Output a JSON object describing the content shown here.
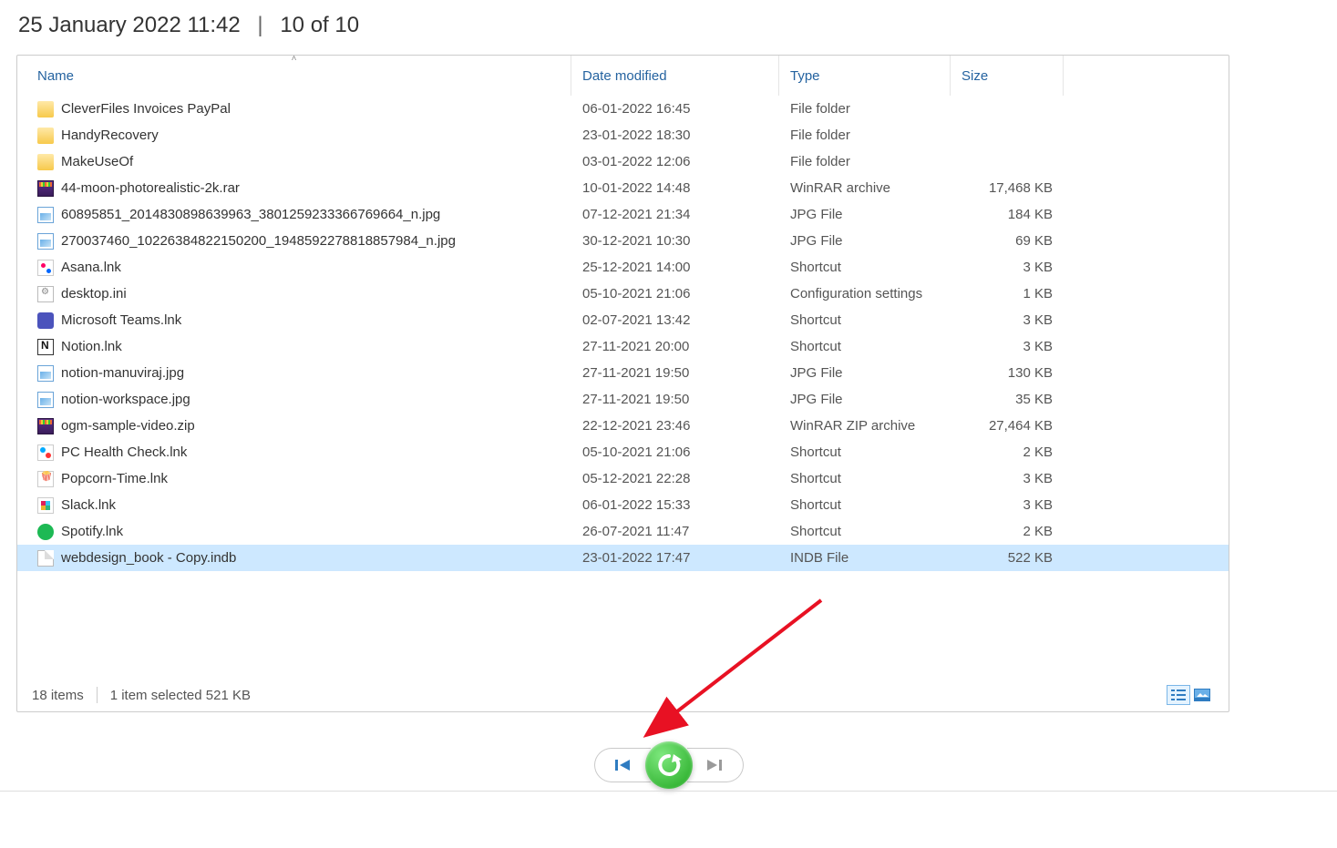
{
  "header": {
    "timestamp": "25 January 2022 11:42",
    "position": "10 of 10"
  },
  "columns": {
    "name": "Name",
    "date": "Date modified",
    "type": "Type",
    "size": "Size"
  },
  "files": [
    {
      "icon": "folder",
      "name": "CleverFiles Invoices PayPal",
      "date": "06-01-2022 16:45",
      "type": "File folder",
      "size": ""
    },
    {
      "icon": "folder",
      "name": "HandyRecovery",
      "date": "23-01-2022 18:30",
      "type": "File folder",
      "size": ""
    },
    {
      "icon": "folder",
      "name": "MakeUseOf",
      "date": "03-01-2022 12:06",
      "type": "File folder",
      "size": ""
    },
    {
      "icon": "rar",
      "name": "44-moon-photorealistic-2k.rar",
      "date": "10-01-2022 14:48",
      "type": "WinRAR archive",
      "size": "17,468 KB"
    },
    {
      "icon": "jpg",
      "name": "60895851_2014830898639963_3801259233366769664_n.jpg",
      "date": "07-12-2021 21:34",
      "type": "JPG File",
      "size": "184 KB"
    },
    {
      "icon": "jpg",
      "name": "270037460_10226384822150200_1948592278818857984_n.jpg",
      "date": "30-12-2021 10:30",
      "type": "JPG File",
      "size": "69 KB"
    },
    {
      "icon": "lnk-asana",
      "name": "Asana.lnk",
      "date": "25-12-2021 14:00",
      "type": "Shortcut",
      "size": "3 KB"
    },
    {
      "icon": "ini",
      "name": "desktop.ini",
      "date": "05-10-2021 21:06",
      "type": "Configuration settings",
      "size": "1 KB"
    },
    {
      "icon": "teams",
      "name": "Microsoft Teams.lnk",
      "date": "02-07-2021 13:42",
      "type": "Shortcut",
      "size": "3 KB"
    },
    {
      "icon": "notion",
      "name": "Notion.lnk",
      "date": "27-11-2021 20:00",
      "type": "Shortcut",
      "size": "3 KB"
    },
    {
      "icon": "jpg",
      "name": "notion-manuviraj.jpg",
      "date": "27-11-2021 19:50",
      "type": "JPG File",
      "size": "130 KB"
    },
    {
      "icon": "jpg",
      "name": "notion-workspace.jpg",
      "date": "27-11-2021 19:50",
      "type": "JPG File",
      "size": "35 KB"
    },
    {
      "icon": "zip",
      "name": "ogm-sample-video.zip",
      "date": "22-12-2021 23:46",
      "type": "WinRAR ZIP archive",
      "size": "27,464 KB"
    },
    {
      "icon": "pchc",
      "name": "PC Health Check.lnk",
      "date": "05-10-2021 21:06",
      "type": "Shortcut",
      "size": "2 KB"
    },
    {
      "icon": "popcorn",
      "name": "Popcorn-Time.lnk",
      "date": "05-12-2021 22:28",
      "type": "Shortcut",
      "size": "3 KB"
    },
    {
      "icon": "slack",
      "name": "Slack.lnk",
      "date": "06-01-2022 15:33",
      "type": "Shortcut",
      "size": "3 KB"
    },
    {
      "icon": "spotify",
      "name": "Spotify.lnk",
      "date": "26-07-2021 11:47",
      "type": "Shortcut",
      "size": "2 KB"
    },
    {
      "icon": "indb",
      "name": "webdesign_book - Copy.indb",
      "date": "23-01-2022 17:47",
      "type": "INDB File",
      "size": "522 KB",
      "selected": true
    }
  ],
  "status": {
    "item_count": "18 items",
    "selection": "1 item selected  521 KB"
  }
}
